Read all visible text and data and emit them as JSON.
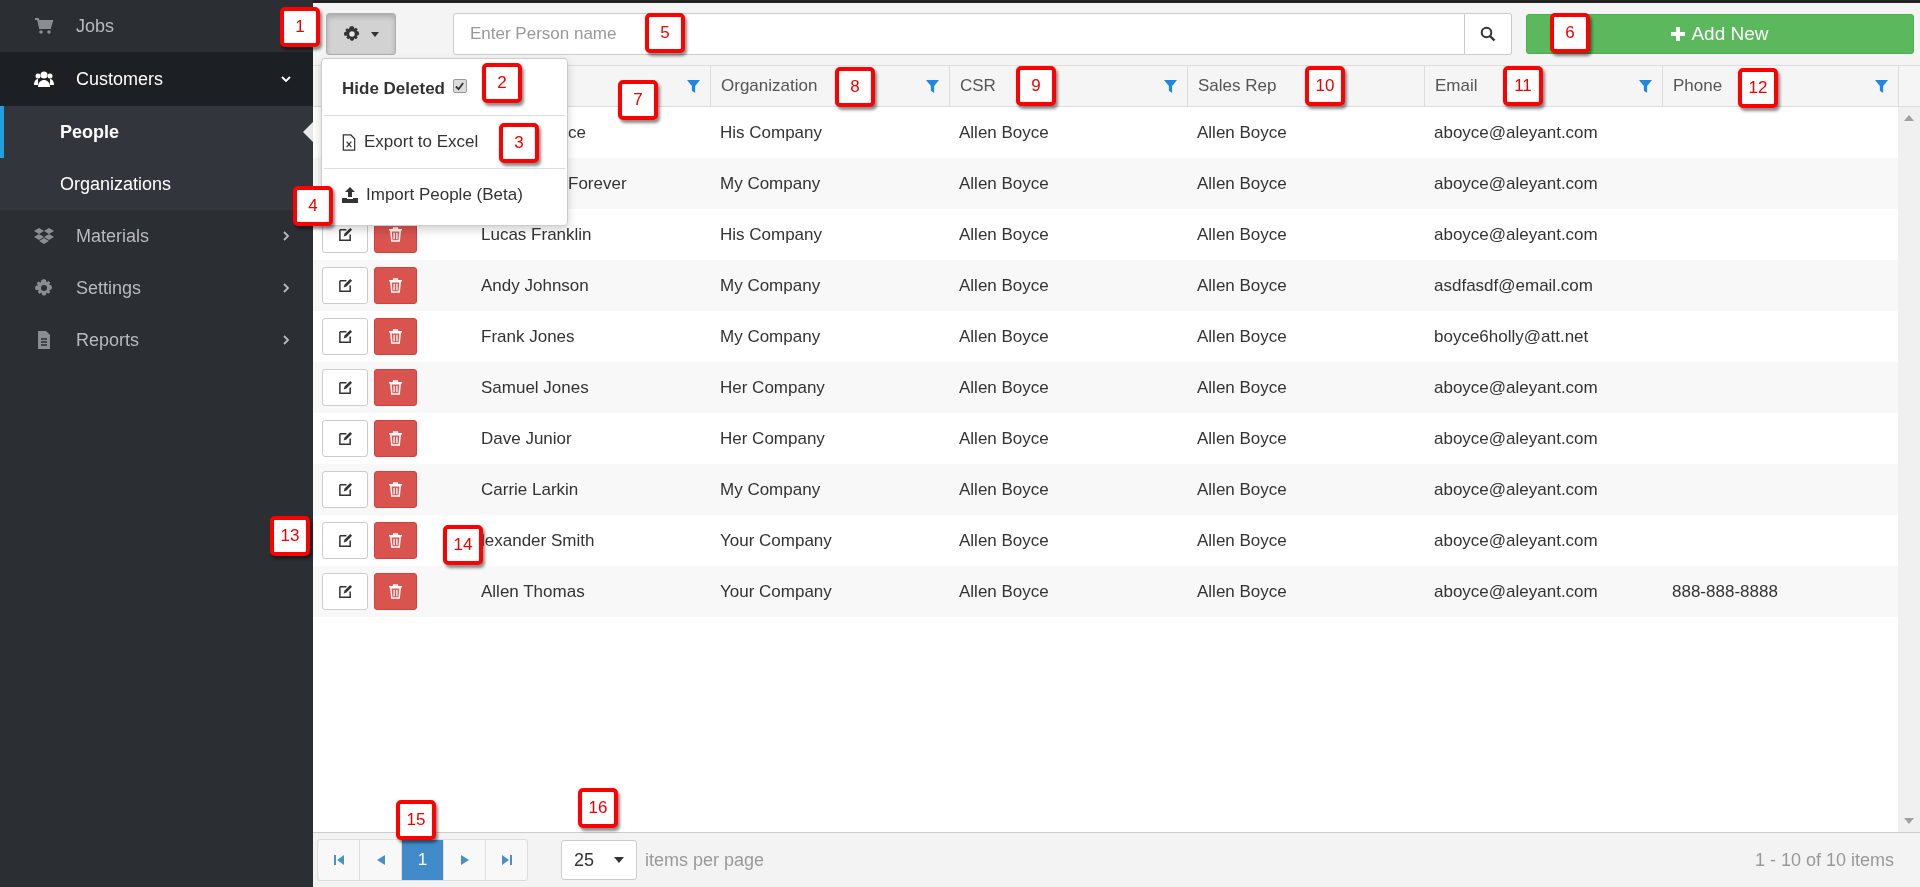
{
  "sidebar": {
    "items": [
      {
        "label": "Jobs",
        "selected": false
      },
      {
        "label": "Customers",
        "selected": true,
        "expanded": true,
        "children": [
          {
            "label": "People",
            "selected": true
          },
          {
            "label": "Organizations",
            "selected": false
          }
        ]
      },
      {
        "label": "Materials",
        "selected": false,
        "expanded": false
      },
      {
        "label": "Settings",
        "selected": false,
        "expanded": false
      },
      {
        "label": "Reports",
        "selected": false,
        "expanded": false
      }
    ]
  },
  "toolbar": {
    "settings_menu": {
      "expanded": true,
      "items": [
        {
          "kind": "checkbox",
          "label": "Hide Deleted",
          "checked": true
        },
        {
          "kind": "export",
          "label": "Export to Excel"
        },
        {
          "kind": "import",
          "label": "Import People (Beta)"
        }
      ]
    },
    "search": {
      "placeholder": "Enter Person name"
    },
    "add_button": {
      "label": "Add New"
    }
  },
  "table": {
    "columns": [
      {
        "filterable": true
      },
      {
        "label": "Organization",
        "filterable": true
      },
      {
        "label": "CSR",
        "filterable": true
      },
      {
        "label": "Sales Rep",
        "filterable": false
      },
      {
        "label": "Email",
        "filterable": true
      },
      {
        "label": "Phone",
        "filterable": true
      }
    ],
    "rows": [
      {
        "name": "ce",
        "organization": "His Company",
        "csr": "Allen Boyce",
        "sales_rep": "Allen Boyce",
        "email": "aboyce@aleyant.com"
      },
      {
        "name": "Forever",
        "organization": "My Company",
        "csr": "Allen Boyce",
        "sales_rep": "Allen Boyce",
        "email": "aboyce@aleyant.com"
      },
      {
        "name": "Lucas Franklin",
        "organization": "His Company",
        "csr": "Allen Boyce",
        "sales_rep": "Allen Boyce",
        "email": "aboyce@aleyant.com"
      },
      {
        "name": "Andy Johnson",
        "organization": "My Company",
        "csr": "Allen Boyce",
        "sales_rep": "Allen Boyce",
        "email": "asdfasdf@email.com"
      },
      {
        "name": "Frank Jones",
        "organization": "My Company",
        "csr": "Allen Boyce",
        "sales_rep": "Allen Boyce",
        "email": "boyce6holly@att.net"
      },
      {
        "name": "Samuel Jones",
        "organization": "Her Company",
        "csr": "Allen Boyce",
        "sales_rep": "Allen Boyce",
        "email": "aboyce@aleyant.com"
      },
      {
        "name": "Dave Junior",
        "organization": "Her Company",
        "csr": "Allen Boyce",
        "sales_rep": "Allen Boyce",
        "email": "aboyce@aleyant.com"
      },
      {
        "name": "Carrie Larkin",
        "organization": "My Company",
        "csr": "Allen Boyce",
        "sales_rep": "Allen Boyce",
        "email": "aboyce@aleyant.com"
      },
      {
        "name": "lexander Smith",
        "organization": "Your Company",
        "csr": "Allen Boyce",
        "sales_rep": "Allen Boyce",
        "email": "aboyce@aleyant.com"
      },
      {
        "name": "Allen Thomas",
        "organization": "Your Company",
        "csr": "Allen Boyce",
        "sales_rep": "Allen Boyce",
        "email": "aboyce@aleyant.com",
        "phone": "888-888-8888"
      }
    ]
  },
  "pager": {
    "pages": [
      {
        "label": "1",
        "selected": true
      }
    ],
    "page_size": "25",
    "page_size_label": "items per page",
    "summary": "1 - 10 of 10 items"
  },
  "callouts": [
    "1",
    "2",
    "3",
    "4",
    "5",
    "6",
    "7",
    "8",
    "9",
    "10",
    "11",
    "12",
    "13",
    "14",
    "15",
    "16"
  ]
}
